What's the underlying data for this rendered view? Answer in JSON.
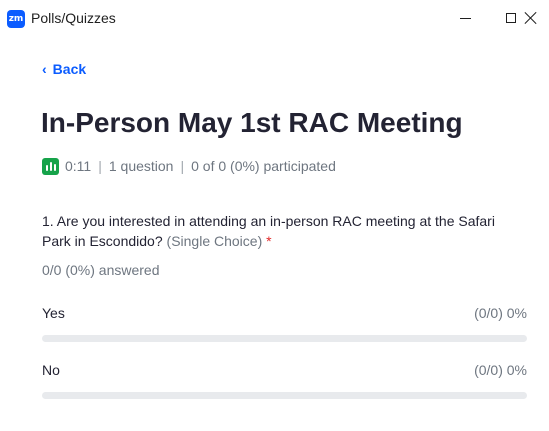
{
  "window": {
    "app_icon_text": "zm",
    "title": "Polls/Quizzes"
  },
  "nav": {
    "back_label": "Back"
  },
  "poll": {
    "title": "In-Person May 1st RAC Meeting",
    "timer": "0:11",
    "question_count": "1 question",
    "participation": "0 of 0 (0%) participated",
    "separator": "|"
  },
  "question": {
    "text": "1. Are you interested in attending an in-person RAC meeting at the Safari Park in Escondido?",
    "type": "(Single Choice)",
    "required_marker": "*",
    "answered": "0/0 (0%) answered",
    "options": [
      {
        "label": "Yes",
        "result": "(0/0) 0%",
        "fraction": 0
      },
      {
        "label": "No",
        "result": "(0/0) 0%",
        "fraction": 0
      }
    ]
  },
  "colors": {
    "accent": "#0b5cff",
    "chart_icon": "#16a34a",
    "required": "#e02828"
  }
}
